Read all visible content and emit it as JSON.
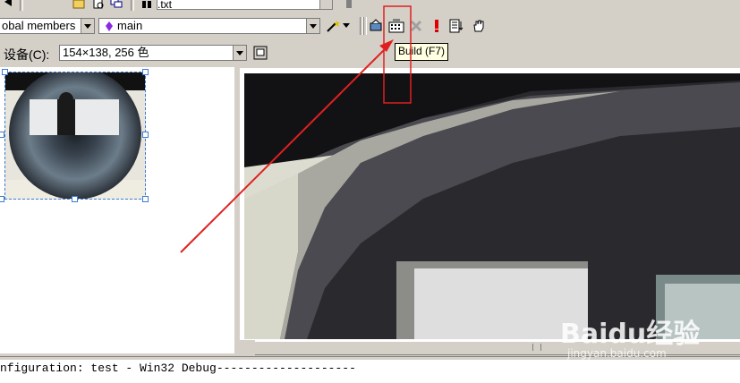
{
  "toolbar_top": {
    "file_field_value": ".txt"
  },
  "toolbar": {
    "members_combo": "obal members",
    "function_combo": "main",
    "tooltip": "Build (F7)"
  },
  "device_row": {
    "label": "设备(C):",
    "value": "154×138, 256 色"
  },
  "output": {
    "text": "nfiguration: test - Win32 Debug--------------------"
  },
  "watermark": {
    "brand": "Baidu经验",
    "url": "jingyan.baidu.com"
  },
  "colors": {
    "annotation_red": "#e02020",
    "tooltip_bg": "#ffffe1",
    "window_bg": "#d4d0c8"
  },
  "icons": [
    "compile-icon",
    "build-icon",
    "stop-build-icon",
    "execute-icon",
    "step-into-icon",
    "breakpoint-hand-icon",
    "wizard-wand-icon",
    "device-icon"
  ]
}
